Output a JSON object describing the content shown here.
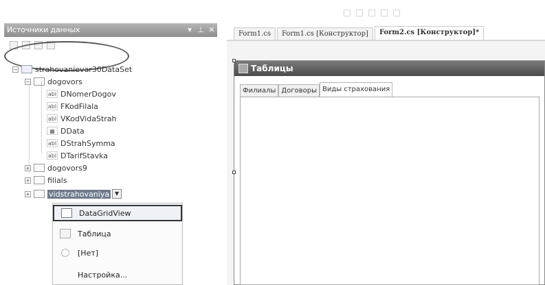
{
  "top_toolbar": {
    "icons": [
      "align-icon",
      "align-icon",
      "align-icon",
      "align-icon",
      "align-icon"
    ]
  },
  "panel": {
    "title": "Источники данных",
    "controls": {
      "dropdown": "▾",
      "pin": "⊥",
      "close": "✕"
    },
    "toolbar_icons": [
      "add-datasource-icon",
      "edit-dataset-icon",
      "configure-icon",
      "refresh-icon"
    ]
  },
  "tree": {
    "dataset": "strahovanievar30DataSet",
    "dogovors": {
      "label": "dogovors",
      "fields": [
        {
          "label": "DNomerDogov",
          "type": "abl"
        },
        {
          "label": "FKodFilala",
          "type": "abl"
        },
        {
          "label": "VKodVidaStrah",
          "type": "abl"
        },
        {
          "label": "DData",
          "type": "date"
        },
        {
          "label": "DStrahSymma",
          "type": "abl"
        },
        {
          "label": "DTarifStavka",
          "type": "abl"
        }
      ]
    },
    "dogovors9": "dogovors9",
    "filials": "filials",
    "vidstrahovaniya": "vidstrahovaniya"
  },
  "context_menu": {
    "items": [
      "DataGridView",
      "Таблица",
      "[Нет]",
      "Настройка..."
    ]
  },
  "doc_tabs": [
    "Form1.cs",
    "Form1.cs [Конструктор]",
    "Form2.cs [Конструктор]*"
  ],
  "form": {
    "title": "Таблицы",
    "tabs": [
      "Филиалы",
      "Договоры",
      "Виды страхования"
    ]
  }
}
